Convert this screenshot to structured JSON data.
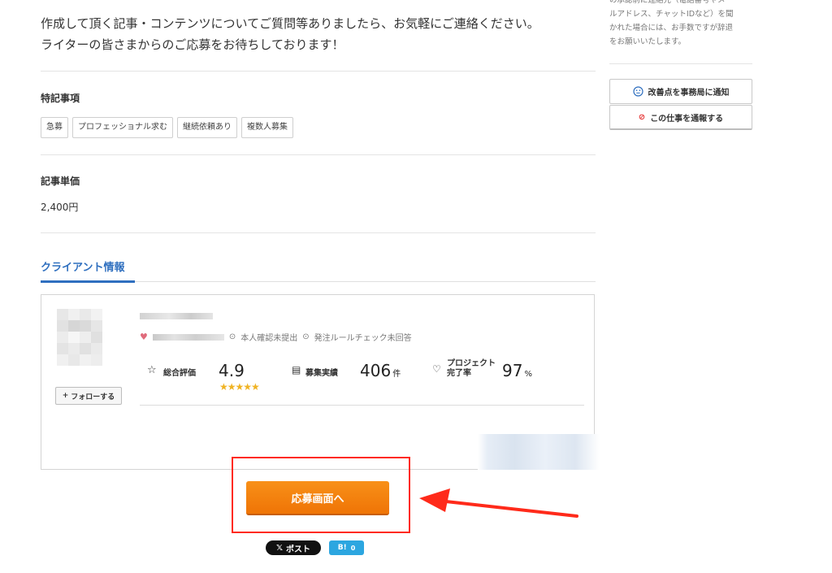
{
  "intro": {
    "line1": "作成して頂く記事・コンテンツについてご質問等ありましたら、お気軽にご連絡ください。",
    "line2": "ライターの皆さまからのご応募をお待ちしております！"
  },
  "notes": {
    "title": "特記事項",
    "tags": [
      "急募",
      "プロフェッショナル求む",
      "継続依頼あり",
      "複数人募集"
    ]
  },
  "price": {
    "title": "記事単価",
    "value": "2,400円"
  },
  "client": {
    "tab_label": "クライアント情報",
    "follow_label": "フォローする",
    "identity_status": "本人確認未提出",
    "rule_check_status": "発注ルールチェック未回答",
    "rating": {
      "label": "総合評価",
      "value": "4.9",
      "stars": 5
    },
    "recruit": {
      "label": "募集実績",
      "value": "406",
      "unit": "件"
    },
    "completion": {
      "label_line1": "プロジェクト",
      "label_line2": "完了率",
      "value": "97",
      "unit": "%"
    }
  },
  "apply_button": "応募画面へ",
  "share": {
    "x_post": "ポスト",
    "hatena_label": "B!",
    "hatena_count": "0"
  },
  "sidebar": {
    "note_lines": [
      "の承認前に連絡先（電話番号やメ",
      "ルアドレス、チャットIDなど）を聞",
      "かれた場合には、お手数ですが辞退",
      "をお願いいたします。"
    ],
    "improve_button": "改善点を事務局に通知",
    "report_button": "この仕事を通報する"
  },
  "colors": {
    "accent_blue": "#2f6fbf",
    "apply_orange": "#f17d0e",
    "annotation_red": "#ff2a1a",
    "star_gold": "#f0b323"
  }
}
